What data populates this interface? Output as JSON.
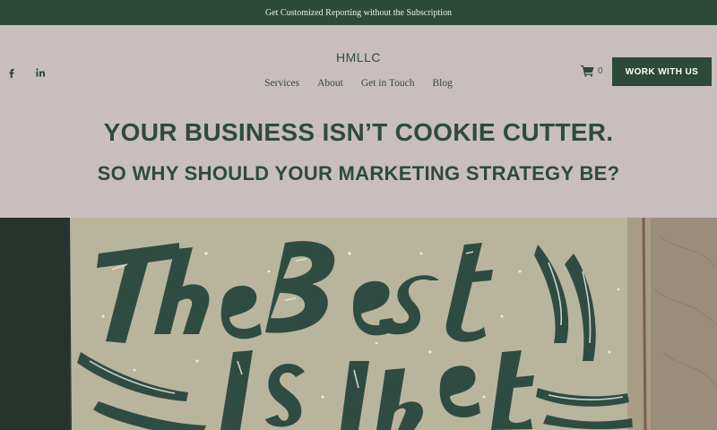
{
  "announcement": "Get Customized Reporting without the Subscription",
  "brand": "HMLLC",
  "nav": [
    "Services",
    "About",
    "Get in Touch",
    "Blog"
  ],
  "cart_count": "0",
  "cta_label": "WORK WITH US",
  "headline": "YOUR BUSINESS ISN’T COOKIE CUTTER.",
  "subheadline": "SO WHY SHOULD YOUR MARKETING STRATEGY BE?",
  "colors": {
    "brand_green": "#2b4a38",
    "header_bg": "#c9bebe",
    "text_green": "#2f4a3f"
  },
  "icons": [
    "facebook-icon",
    "linkedin-icon",
    "cart-icon"
  ],
  "hero_image": {
    "lettering": "The Best Is yet"
  }
}
